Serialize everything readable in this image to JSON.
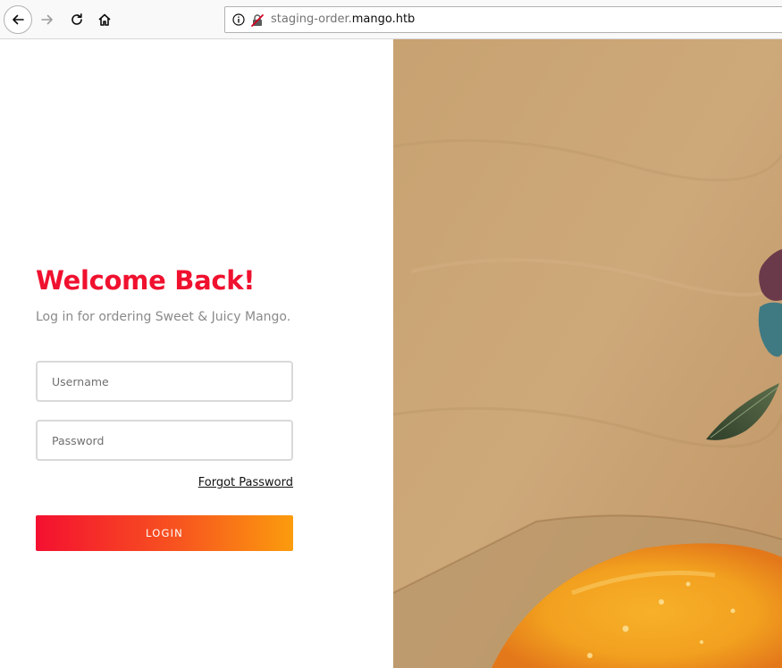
{
  "browser": {
    "url_prefix": "staging-order.",
    "url_host": "mango.htb",
    "icons": {
      "back": "back-arrow-icon",
      "forward": "forward-arrow-icon",
      "reload": "reload-icon",
      "home": "home-icon",
      "info": "info-icon",
      "insecure": "insecure-lock-icon"
    }
  },
  "login": {
    "title": "Welcome Back!",
    "subtitle": "Log in for ordering Sweet & Juicy Mango.",
    "username_placeholder": "Username",
    "password_placeholder": "Password",
    "forgot_label": "Forgot Password",
    "login_label": "LOGIN"
  },
  "colors": {
    "accent": "#f0112f",
    "button_gradient_start": "#f41030",
    "button_gradient_end": "#fb9c0d",
    "muted_text": "#8a8a8a"
  }
}
